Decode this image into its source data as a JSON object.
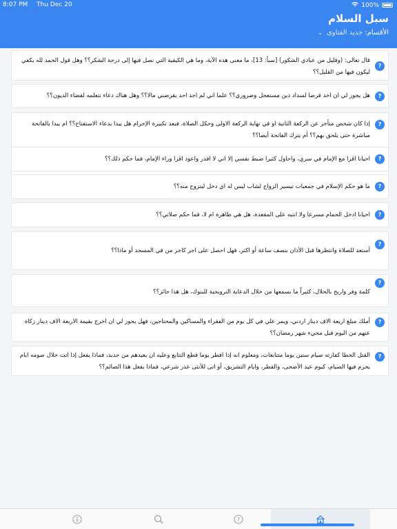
{
  "status": {
    "time": "8:07 PM",
    "date": "Thu Dec 20",
    "battery": "100%"
  },
  "header": {
    "title": "سبل السلام",
    "section_label": "الأقسام:",
    "section_value": "جديد الفتاوى"
  },
  "icon_names": {
    "question": "question-mark-icon",
    "home": "home-icon",
    "help": "help-icon",
    "search": "search-icon",
    "info": "info-icon"
  },
  "accent": "#3a86f0",
  "questions": [
    {
      "q": "?",
      "text": "قال تعالى: (وقليل من عبادي الشكور) [سبأ: 13]، ما معنى هذه الآية، وما هي الكيفية التي نصل فيها إلى درجة الشكر؟؟ وهل قول الحمد لله يكفي ليكون فيها من القليل؟؟"
    },
    {
      "q": "?",
      "text": "هل يجوز لي ان اخذ قرضا لسداد دين مستعجل وضروري؟؟ علما اني لم اجد احد يقرضني مالا؟؟ وهل هناك دعاء نتعلمه لقضاء الديون؟؟"
    },
    {
      "q": "?",
      "text": "إذا كان شخص متأخر عن الركعة الثانية او في نهاية الركعة الاولى وحكل الصلاة، فبعد تكبيرة الإحرام هل يبدا بدعاء الاستفتاح؟؟ ام يبدا بالفاتحة مباشرة حتى يلحق بهم؟؟ أم يترك الفاتحة أيضا؟؟"
    },
    {
      "q": "?",
      "text": "احيانا اقرا مع الإمام في سري، واحاول كثيرا ضبط نفسي إلا اني لا اقدر واعود اقرا وراء الإمام، فما حكم ذلك؟؟"
    },
    {
      "q": "?",
      "text": "ما هو حكم الإسلام في جمعيات تيسير الزواج لشاب ليس له اي دخل ليتزوج منه؟؟"
    },
    {
      "q": "?",
      "text": "احيانا ادخل الحمام مسرعا ولا انتبه على المقعدة، هل هي طاهرة ام لا، فما حكم صلاتي؟؟"
    },
    {
      "q": "?",
      "text": "أستعد للصلاة وانتظرها قبل الأذان بنصف ساعة أو اكثر، فهل احصل على اجر كاجر من في المسجد أو ماذا؟؟"
    },
    {
      "q": "?",
      "text": "كلمة وفر واربح بالحلال، كثيراً ما نسمعها من خلال الدعاية الترويجية للبنوك، هل هذا جائز؟؟"
    },
    {
      "q": "?",
      "text": "أملك مبلغ اربعة الاف دينار اردني، ويمر علي في كل يوم من الفقراء والمساكين والمحتاجين، فهل يجوز لي ان اخرج بقيمة الاربعة الاف دينار زكاة عنهم من اليوم قبل مجيء شهر رمضان؟؟"
    },
    {
      "q": "?",
      "text": "القتل الخطا كفارته صيام ستين يوما متتابعات، ومعلوم انه إذا افطر يوما قطع التتابع وعليه ان يعيدهم من جديد، فماذا يفعل إذا اتت خلال صومه ايام يحرم فيها الصيام، كيوم عيد الأضحى، والفطر، وايام التشريق، أو اتى للأنثى عذر شرعي، فماذا يفعل هذا الصائم؟؟"
    }
  ]
}
